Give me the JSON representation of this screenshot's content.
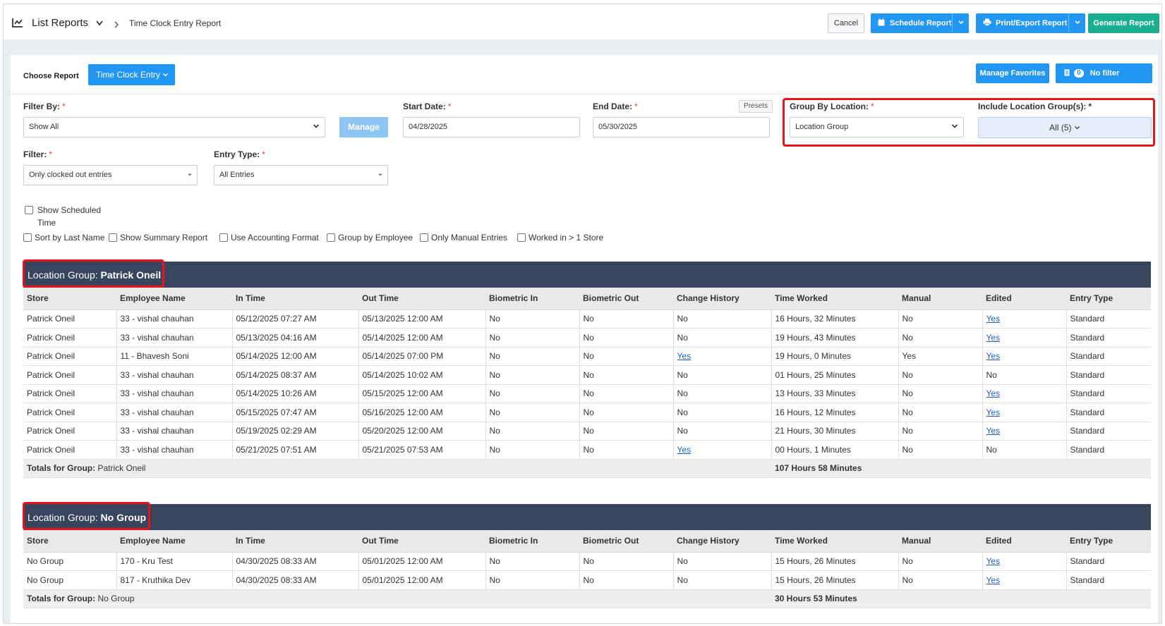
{
  "header": {
    "title": "List Reports",
    "breadcrumb": "Time Clock Entry Report",
    "cancel": "Cancel",
    "schedule": "Schedule Report",
    "print": "Print/Export Report",
    "generate": "Generate Report"
  },
  "panel": {
    "choose_label": "Choose Report",
    "choose_value": "Time Clock Entry",
    "manage_favorites": "Manage Favorites",
    "filter_count": "0",
    "no_filter": "No filter selected"
  },
  "filters": {
    "filter_by_label": "Filter By:",
    "filter_by_value": "Show All",
    "manage": "Manage",
    "start_label": "Start Date:",
    "start_value": "04/28/2025",
    "end_label": "End Date:",
    "end_value": "05/30/2025",
    "presets": "Presets",
    "group_label": "Group By Location:",
    "group_value": "Location Group",
    "include_label": "Include Location Group(s):",
    "include_value": "All (5)",
    "filter_label": "Filter:",
    "filter_value": "Only clocked out entries",
    "entry_type_label": "Entry Type:",
    "entry_type_value": "All Entries",
    "required_mark": "*"
  },
  "options": {
    "show_scheduled": "Show Scheduled",
    "show_scheduled_2": "Time",
    "sort_last": "Sort by Last Name",
    "summary": "Show Summary Report",
    "accounting": "Use Accounting Format",
    "group_employee": "Group by Employee",
    "manual_only": "Only Manual Entries",
    "worked_store": "Worked in > 1 Store"
  },
  "columns": [
    "Store",
    "Employee Name",
    "In Time",
    "Out Time",
    "Biometric In",
    "Biometric Out",
    "Change History",
    "Time Worked",
    "Manual",
    "Edited",
    "Entry Type"
  ],
  "groups": [
    {
      "label": "Location Group:",
      "name": "Patrick Oneil",
      "rows": [
        [
          "Patrick Oneil",
          "33 - vishal chauhan",
          "05/12/2025 07:27 AM",
          "05/13/2025 12:00 AM",
          "No",
          "No",
          "No",
          "16 Hours, 32 Minutes",
          "No",
          "Yes",
          "Standard"
        ],
        [
          "Patrick Oneil",
          "33 - vishal chauhan",
          "05/13/2025 04:16 AM",
          "05/14/2025 12:00 AM",
          "No",
          "No",
          "No",
          "19 Hours, 43 Minutes",
          "No",
          "Yes",
          "Standard"
        ],
        [
          "Patrick Oneil",
          "11 - Bhavesh Soni",
          "05/14/2025 12:00 AM",
          "05/14/2025 07:00 PM",
          "No",
          "No",
          "Yes",
          "19 Hours, 0 Minutes",
          "Yes",
          "Yes",
          "Standard"
        ],
        [
          "Patrick Oneil",
          "33 - vishal chauhan",
          "05/14/2025 08:37 AM",
          "05/14/2025 10:02 AM",
          "No",
          "No",
          "No",
          "01 Hours, 25 Minutes",
          "No",
          "No",
          "Standard"
        ],
        [
          "Patrick Oneil",
          "33 - vishal chauhan",
          "05/14/2025 10:26 AM",
          "05/15/2025 12:00 AM",
          "No",
          "No",
          "No",
          "13 Hours, 33 Minutes",
          "No",
          "Yes",
          "Standard"
        ],
        [
          "Patrick Oneil",
          "33 - vishal chauhan",
          "05/15/2025 07:47 AM",
          "05/16/2025 12:00 AM",
          "No",
          "No",
          "No",
          "16 Hours, 12 Minutes",
          "No",
          "Yes",
          "Standard"
        ],
        [
          "Patrick Oneil",
          "33 - vishal chauhan",
          "05/19/2025 02:29 AM",
          "05/20/2025 12:00 AM",
          "No",
          "No",
          "No",
          "21 Hours, 30 Minutes",
          "No",
          "Yes",
          "Standard"
        ],
        [
          "Patrick Oneil",
          "33 - vishal chauhan",
          "05/21/2025 07:51 AM",
          "05/21/2025 07:53 AM",
          "No",
          "No",
          "Yes",
          "00 Hours, 1 Minutes",
          "No",
          "No",
          "Standard"
        ]
      ],
      "totals_label": "Totals for Group:",
      "totals_name": "Patrick Oneil",
      "totals_value": "107 Hours 58 Minutes"
    },
    {
      "label": "Location Group:",
      "name": "No Group",
      "rows": [
        [
          "No Group",
          "170 - Kru Test",
          "04/30/2025 08:33 AM",
          "05/01/2025 12:00 AM",
          "No",
          "No",
          "No",
          "15 Hours, 26 Minutes",
          "No",
          "Yes",
          "Standard"
        ],
        [
          "No Group",
          "817 - Kruthika Dev",
          "04/30/2025 08:33 AM",
          "05/01/2025 12:00 AM",
          "No",
          "No",
          "No",
          "15 Hours, 26 Minutes",
          "No",
          "Yes",
          "Standard"
        ]
      ],
      "totals_label": "Totals for Group:",
      "totals_name": "No Group",
      "totals_value": "30 Hours 53 Minutes"
    }
  ],
  "colors": {
    "primary": "#2196f3",
    "success": "#1aaf91",
    "group_header": "#39445f",
    "highlight": "#e8141b",
    "link": "#1f5fbf"
  }
}
